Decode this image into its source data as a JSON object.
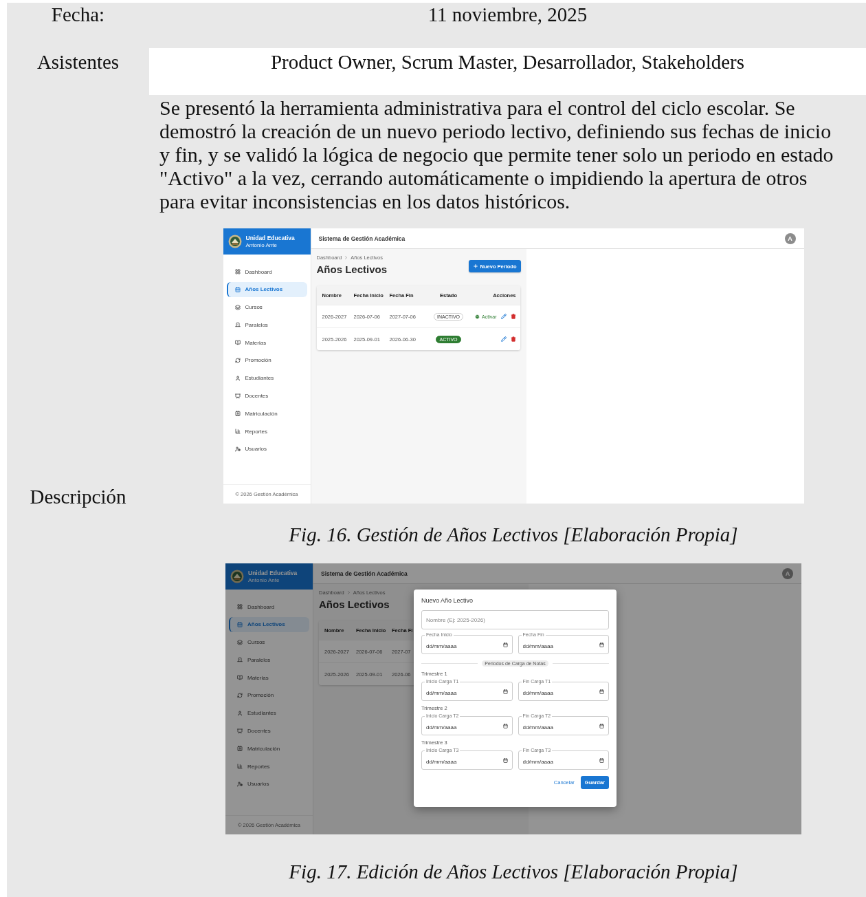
{
  "document": {
    "rows": [
      {
        "kind": "plain",
        "label": "Fecha:",
        "value": "11 noviembre, 2025"
      },
      {
        "kind": "boxed",
        "label": "Asistentes",
        "value": "Product Owner, Scrum Master, Desarrollador, Stakeholders"
      },
      {
        "kind": "description",
        "label": "Descripción",
        "paragraph": "Se presentó la herramienta administrativa para el control del ciclo escolar. Se demostró la creación de un nuevo periodo lectivo, definiendo sus fechas de inicio y fin, y se validó la lógica de negocio que permite tener solo un periodo en estado \"Activo\" a la vez, cerrando automáticamente o impidiendo la apertura de otros para evitar inconsistencias en los datos históricos.",
        "figures": [
          {
            "caption": "Fig. 16. Gestión de Años Lectivos [Elaboración Propia]",
            "screenshot": {
              "brand": {
                "title": "Unidad Educativa",
                "subtitle": "Antonio Ante"
              },
              "app_title": "Sistema de Gestión Académica",
              "avatar": "A",
              "nav": [
                {
                  "label": "Dashboard",
                  "selected": false
                },
                {
                  "label": "Años Lectivos",
                  "selected": true
                },
                {
                  "label": "Cursos",
                  "selected": false
                },
                {
                  "label": "Paralelos",
                  "selected": false
                },
                {
                  "label": "Materias",
                  "selected": false
                },
                {
                  "label": "Promoción",
                  "selected": false
                },
                {
                  "label": "Estudiantes",
                  "selected": false
                },
                {
                  "label": "Docentes",
                  "selected": false
                },
                {
                  "label": "Matriculación",
                  "selected": false
                },
                {
                  "label": "Reportes",
                  "selected": false
                },
                {
                  "label": "Usuarios",
                  "selected": false
                }
              ],
              "footer": "© 2026 Gestión Académica",
              "breadcrumb": [
                "Dashboard",
                "Años Lectivos"
              ],
              "page_title": "Años Lectivos",
              "new_button": "Nuevo Periodo",
              "table": {
                "columns": [
                  "Nombre",
                  "Fecha Inicio",
                  "Fecha Fin",
                  "Estado",
                  "Acciones"
                ],
                "rows": [
                  {
                    "cells": [
                      "2026-2027",
                      "2026-07-06",
                      "2027-07-06"
                    ],
                    "status": {
                      "label": "INACTIVO",
                      "active": false
                    },
                    "activate": "Activar"
                  },
                  {
                    "cells": [
                      "2025-2026",
                      "2025-09-01",
                      "2026-06-30"
                    ],
                    "status": {
                      "label": "ACTIVO",
                      "active": true
                    }
                  }
                ]
              }
            }
          },
          {
            "caption": "Fig. 17. Edición de Años Lectivos [Elaboración Propia]",
            "screenshot": {
              "brand": {
                "title": "Unidad Educativa",
                "subtitle": "Antonio Ante"
              },
              "app_title": "Sistema de Gestión Académica",
              "avatar": "A",
              "nav": [
                {
                  "label": "Dashboard",
                  "selected": false
                },
                {
                  "label": "Años Lectivos",
                  "selected": true
                },
                {
                  "label": "Cursos",
                  "selected": false
                },
                {
                  "label": "Paralelos",
                  "selected": false
                },
                {
                  "label": "Materias",
                  "selected": false
                },
                {
                  "label": "Promoción",
                  "selected": false
                },
                {
                  "label": "Estudiantes",
                  "selected": false
                },
                {
                  "label": "Docentes",
                  "selected": false
                },
                {
                  "label": "Matriculación",
                  "selected": false
                },
                {
                  "label": "Reportes",
                  "selected": false
                },
                {
                  "label": "Usuarios",
                  "selected": false
                }
              ],
              "footer": "© 2026 Gestión Académica",
              "breadcrumb": [
                "Dashboard",
                "Años Lectivos"
              ],
              "page_title": "Años Lectivos",
              "table": {
                "columns": [
                  "Nombre",
                  "Fecha Inicio",
                  "Fecha Fi"
                ],
                "rows": [
                  {
                    "cells": [
                      "2026-2027",
                      "2026-07-06",
                      "2027-07"
                    ]
                  },
                  {
                    "cells": [
                      "2025-2026",
                      "2025-09-01",
                      "2026-06"
                    ]
                  }
                ]
              },
              "dialog": {
                "title": "Nuevo Año Lectivo",
                "name_field": {
                  "placeholder": "Nombre (Ej: 2025-2026)"
                },
                "date_fields": [
                  {
                    "label": "Fecha Inicio",
                    "placeholder": "dd/mm/aaaa"
                  },
                  {
                    "label": "Fecha Fin",
                    "placeholder": "dd/mm/aaaa"
                  }
                ],
                "divider": "Periodos de Carga de Notas",
                "terms": [
                  {
                    "title": "Trimestre 1",
                    "fields": [
                      {
                        "label": "Inicio Carga T1",
                        "placeholder": "dd/mm/aaaa"
                      },
                      {
                        "label": "Fin Carga T1",
                        "placeholder": "dd/mm/aaaa"
                      }
                    ]
                  },
                  {
                    "title": "Trimestre 2",
                    "fields": [
                      {
                        "label": "Inicio Carga T2",
                        "placeholder": "dd/mm/aaaa"
                      },
                      {
                        "label": "Fin Carga T2",
                        "placeholder": "dd/mm/aaaa"
                      }
                    ]
                  },
                  {
                    "title": "Trimestre 3",
                    "fields": [
                      {
                        "label": "Inicio Carga T3",
                        "placeholder": "dd/mm/aaaa"
                      },
                      {
                        "label": "Fin Carga T3",
                        "placeholder": "dd/mm/aaaa"
                      }
                    ]
                  }
                ],
                "buttons": [
                  {
                    "label": "Cancelar",
                    "kind": "text"
                  },
                  {
                    "label": "Guardar",
                    "kind": "primary"
                  }
                ]
              }
            }
          }
        ]
      }
    ]
  }
}
